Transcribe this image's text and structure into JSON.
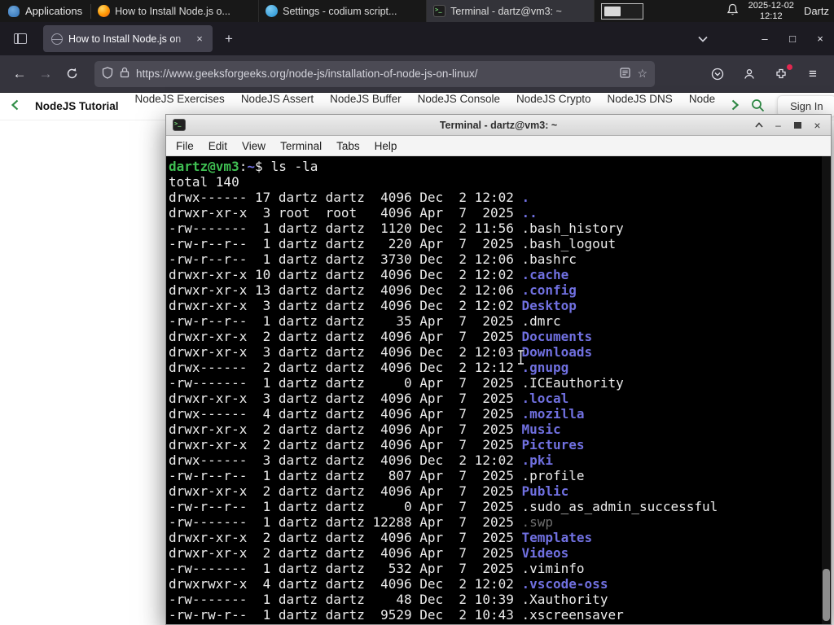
{
  "taskbar": {
    "applications": "Applications",
    "windows": [
      {
        "icon": "firefox",
        "label": "How to Install Node.js o...",
        "active": false
      },
      {
        "icon": "codium",
        "label": "Settings - codium script...",
        "active": false
      },
      {
        "icon": "terminal",
        "label": "Terminal - dartz@vm3: ~",
        "active": true
      }
    ],
    "date": "2025-12-02",
    "time": "12:12",
    "user": "Dartz"
  },
  "glyphs": {
    "back": "←",
    "forward": "→",
    "menu": "≡",
    "plus": "+",
    "close": "×",
    "minimize": "–",
    "maximize": "□",
    "star": "☆"
  },
  "browser": {
    "tab_title": "How to Install Node.js on",
    "url": "https://www.geeksforgeeks.org/node-js/installation-of-node-js-on-linux/"
  },
  "site_nav": {
    "active": "NodeJS Tutorial",
    "items": [
      "NodeJS Exercises",
      "NodeJS Assert",
      "NodeJS Buffer",
      "NodeJS Console",
      "NodeJS Crypto",
      "NodeJS DNS",
      "Node"
    ],
    "sign_in": "Sign In"
  },
  "terminal": {
    "title": "Terminal - dartz@vm3: ~",
    "menu": [
      "File",
      "Edit",
      "View",
      "Terminal",
      "Tabs",
      "Help"
    ],
    "prompt_user": "dartz@vm3",
    "prompt_sep": ":",
    "prompt_dir": "~",
    "prompt_symbol": "$",
    "command": "ls -la",
    "total_line": "total 140",
    "listing": [
      {
        "pre": "drwx------ 17 dartz dartz  4096 Dec  2 12:02 ",
        "name": ".",
        "type": "dir"
      },
      {
        "pre": "drwxr-xr-x  3 root  root   4096 Apr  7  2025 ",
        "name": "..",
        "type": "dir"
      },
      {
        "pre": "-rw-------  1 dartz dartz  1120 Dec  2 11:56 ",
        "name": ".bash_history",
        "type": "file"
      },
      {
        "pre": "-rw-r--r--  1 dartz dartz   220 Apr  7  2025 ",
        "name": ".bash_logout",
        "type": "file"
      },
      {
        "pre": "-rw-r--r--  1 dartz dartz  3730 Dec  2 12:06 ",
        "name": ".bashrc",
        "type": "file"
      },
      {
        "pre": "drwxr-xr-x 10 dartz dartz  4096 Dec  2 12:02 ",
        "name": ".cache",
        "type": "dir"
      },
      {
        "pre": "drwxr-xr-x 13 dartz dartz  4096 Dec  2 12:06 ",
        "name": ".config",
        "type": "dir"
      },
      {
        "pre": "drwxr-xr-x  3 dartz dartz  4096 Dec  2 12:02 ",
        "name": "Desktop",
        "type": "dir"
      },
      {
        "pre": "-rw-r--r--  1 dartz dartz    35 Apr  7  2025 ",
        "name": ".dmrc",
        "type": "file"
      },
      {
        "pre": "drwxr-xr-x  2 dartz dartz  4096 Apr  7  2025 ",
        "name": "Documents",
        "type": "dir"
      },
      {
        "pre": "drwxr-xr-x  3 dartz dartz  4096 Dec  2 12:03 ",
        "name": "Downloads",
        "type": "dir"
      },
      {
        "pre": "drwx------  2 dartz dartz  4096 Dec  2 12:12 ",
        "name": ".gnupg",
        "type": "dir"
      },
      {
        "pre": "-rw-------  1 dartz dartz     0 Apr  7  2025 ",
        "name": ".ICEauthority",
        "type": "file"
      },
      {
        "pre": "drwxr-xr-x  3 dartz dartz  4096 Apr  7  2025 ",
        "name": ".local",
        "type": "dir"
      },
      {
        "pre": "drwx------  4 dartz dartz  4096 Apr  7  2025 ",
        "name": ".mozilla",
        "type": "dir"
      },
      {
        "pre": "drwxr-xr-x  2 dartz dartz  4096 Apr  7  2025 ",
        "name": "Music",
        "type": "dir"
      },
      {
        "pre": "drwxr-xr-x  2 dartz dartz  4096 Apr  7  2025 ",
        "name": "Pictures",
        "type": "dir"
      },
      {
        "pre": "drwx------  3 dartz dartz  4096 Dec  2 12:02 ",
        "name": ".pki",
        "type": "dir"
      },
      {
        "pre": "-rw-r--r--  1 dartz dartz   807 Apr  7  2025 ",
        "name": ".profile",
        "type": "file"
      },
      {
        "pre": "drwxr-xr-x  2 dartz dartz  4096 Apr  7  2025 ",
        "name": "Public",
        "type": "dir"
      },
      {
        "pre": "-rw-r--r--  1 dartz dartz     0 Apr  7  2025 ",
        "name": ".sudo_as_admin_successful",
        "type": "file"
      },
      {
        "pre": "-rw-------  1 dartz dartz 12288 Apr  7  2025 ",
        "name": ".swp",
        "type": "dim"
      },
      {
        "pre": "drwxr-xr-x  2 dartz dartz  4096 Apr  7  2025 ",
        "name": "Templates",
        "type": "dir"
      },
      {
        "pre": "drwxr-xr-x  2 dartz dartz  4096 Apr  7  2025 ",
        "name": "Videos",
        "type": "dir"
      },
      {
        "pre": "-rw-------  1 dartz dartz   532 Apr  7  2025 ",
        "name": ".viminfo",
        "type": "file"
      },
      {
        "pre": "drwxrwxr-x  4 dartz dartz  4096 Dec  2 12:02 ",
        "name": ".vscode-oss",
        "type": "dir"
      },
      {
        "pre": "-rw-------  1 dartz dartz    48 Dec  2 10:39 ",
        "name": ".Xauthority",
        "type": "file"
      },
      {
        "pre": "-rw-rw-r--  1 dartz dartz  9529 Dec  2 10:43 ",
        "name": ".xscreensaver",
        "type": "file"
      }
    ]
  }
}
